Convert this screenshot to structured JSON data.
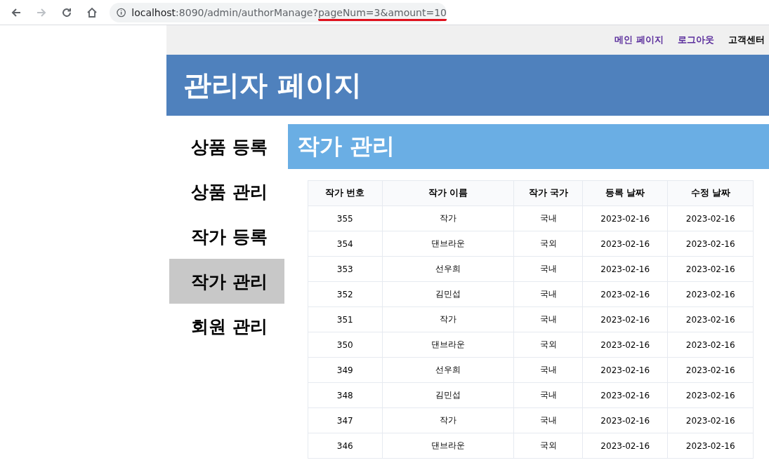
{
  "browser": {
    "url": {
      "host": "localhost",
      "path": ":8090/admin/authorManage?",
      "query": "pageNum=3&amount=10"
    },
    "query_underlined": true,
    "forward_disabled": true
  },
  "top_nav": [
    {
      "label": "메인 페이지",
      "color": "#5a2d9c"
    },
    {
      "label": "로그아웃",
      "color": "#5a2d9c"
    },
    {
      "label": "고객센터",
      "color": "#000000"
    }
  ],
  "header": {
    "title": "관리자 페이지"
  },
  "sidebar": {
    "items": [
      {
        "label": "상품 등록",
        "selected": false
      },
      {
        "label": "상품 관리",
        "selected": false
      },
      {
        "label": "작가 등록",
        "selected": false
      },
      {
        "label": "작가 관리",
        "selected": true
      },
      {
        "label": "회원 관리",
        "selected": false
      }
    ]
  },
  "content": {
    "title": "작가 관리"
  },
  "table": {
    "columns": [
      "작가 번호",
      "작가 이름",
      "작가 국가",
      "등록 날짜",
      "수정 날짜"
    ],
    "rows": [
      [
        "355",
        "작가",
        "국내",
        "2023-02-16",
        "2023-02-16"
      ],
      [
        "354",
        "댄브라운",
        "국외",
        "2023-02-16",
        "2023-02-16"
      ],
      [
        "353",
        "선우희",
        "국내",
        "2023-02-16",
        "2023-02-16"
      ],
      [
        "352",
        "김민섭",
        "국내",
        "2023-02-16",
        "2023-02-16"
      ],
      [
        "351",
        "작가",
        "국내",
        "2023-02-16",
        "2023-02-16"
      ],
      [
        "350",
        "댄브라운",
        "국외",
        "2023-02-16",
        "2023-02-16"
      ],
      [
        "349",
        "선우희",
        "국내",
        "2023-02-16",
        "2023-02-16"
      ],
      [
        "348",
        "김민섭",
        "국내",
        "2023-02-16",
        "2023-02-16"
      ],
      [
        "347",
        "작가",
        "국내",
        "2023-02-16",
        "2023-02-16"
      ],
      [
        "346",
        "댄브라운",
        "국외",
        "2023-02-16",
        "2023-02-16"
      ]
    ]
  }
}
